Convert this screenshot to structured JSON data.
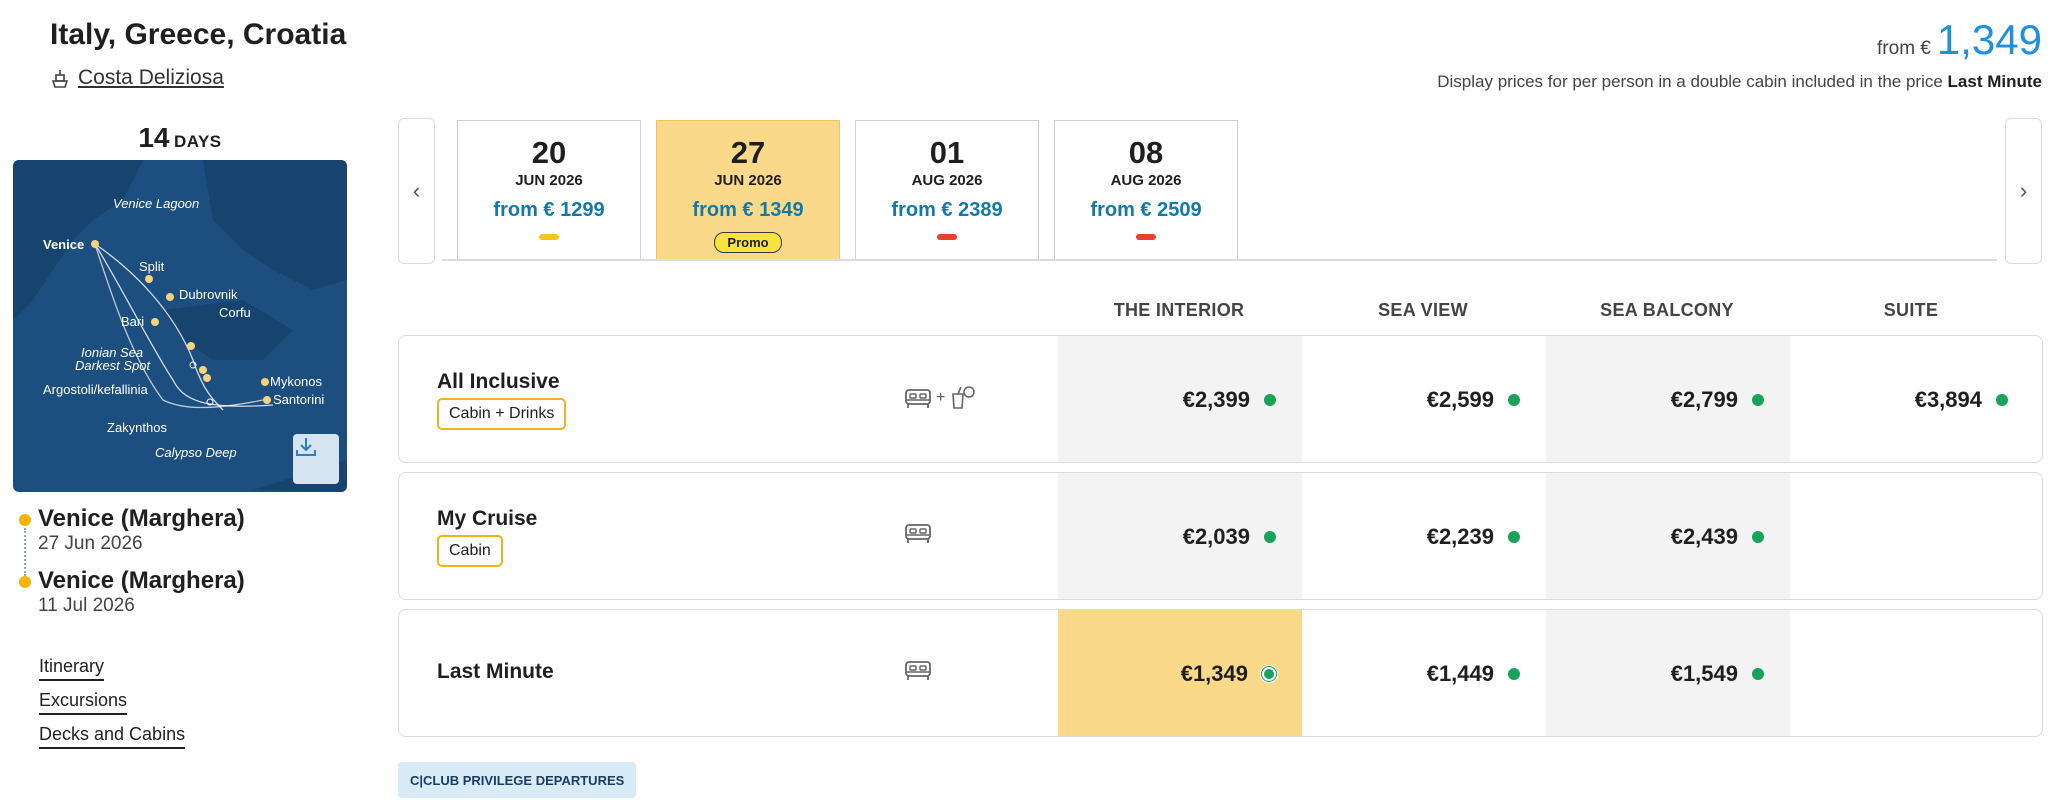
{
  "header": {
    "title": "Italy, Greece, Croatia",
    "ship_name": "Costa Deliziosa",
    "from_label": "from €",
    "from_price": "1,349",
    "display_note": "Display prices for per person in a double cabin included in the price",
    "display_note_bold": "Last Minute"
  },
  "trip": {
    "days_number": "14",
    "days_label": "DAYS"
  },
  "map": {
    "labels": [
      "Venice Lagoon",
      "Venice",
      "Split",
      "Dubrovnik",
      "Corfu",
      "Bari",
      "Ionian Sea",
      "Darkest Spot",
      "Argostoli/kefallinia",
      "Mykonos",
      "Santorini",
      "Zakynthos",
      "Calypso Deep"
    ]
  },
  "ports": [
    {
      "name": "Venice (Marghera)",
      "date": "27 Jun 2026"
    },
    {
      "name": "Venice (Marghera)",
      "date": "11 Jul 2026"
    }
  ],
  "side_links": [
    "Itinerary",
    "Excursions",
    "Decks and Cabins"
  ],
  "dates": [
    {
      "day": "20",
      "month": "JUN 2026",
      "price": "from € 1299",
      "indicator_color": "#f5c518",
      "promo": ""
    },
    {
      "day": "27",
      "month": "JUN 2026",
      "price": "from € 1349",
      "indicator_color": "",
      "promo": "Promo"
    },
    {
      "day": "01",
      "month": "AUG 2026",
      "price": "from € 2389",
      "indicator_color": "#e8412c",
      "promo": ""
    },
    {
      "day": "08",
      "month": "AUG 2026",
      "price": "from € 2509",
      "indicator_color": "#e8412c",
      "promo": ""
    }
  ],
  "columns": [
    "THE INTERIOR",
    "SEA VIEW",
    "SEA BALCONY",
    "SUITE"
  ],
  "rows": [
    {
      "name": "All Inclusive",
      "badge": "Cabin + Drinks",
      "prices": [
        "€2,399",
        "€2,599",
        "€2,799",
        "€3,894"
      ]
    },
    {
      "name": "My Cruise",
      "badge": "Cabin",
      "prices": [
        "€2,039",
        "€2,239",
        "€2,439",
        ""
      ]
    },
    {
      "name": "Last Minute",
      "badge": "",
      "prices": [
        "€1,349",
        "€1,449",
        "€1,549",
        ""
      ]
    }
  ],
  "club_label": "C|CLUB PRIVILEGE DEPARTURES",
  "colors": {
    "accent_blue": "#1f8fe0",
    "price_blue": "#1479a8",
    "highlight": "#fbd98a",
    "available_green": "#17a35a",
    "port_yellow": "#f5b400"
  }
}
